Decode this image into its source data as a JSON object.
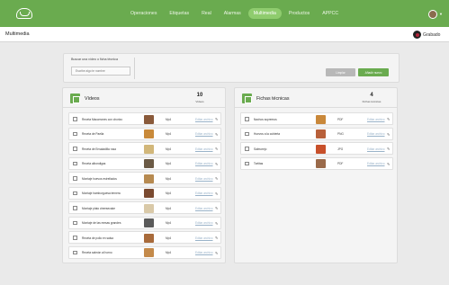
{
  "nav": {
    "items": [
      "Operaciones",
      "Etiquetas",
      "Real",
      "Alarmas",
      "Multimedia",
      "Productos",
      "APPCC"
    ],
    "active_index": 4
  },
  "subbar": {
    "title": "Multimedia",
    "record_label": "Grabado"
  },
  "search": {
    "label": "Buscar una vídeo o ficha técnica",
    "placeholder": "Escribe algo te nombre",
    "clear_label": "Limpiar",
    "add_label": "Añadir nuevo"
  },
  "videos": {
    "title": "Vídeos",
    "count": "10",
    "count_label": "Vídeos",
    "rows": [
      {
        "name": "Receta Macarrones con chorizo",
        "format": "Mp4",
        "edit": "Editar archivo",
        "thumb": "#8a5a3a"
      },
      {
        "name": "Receta de Paella",
        "format": "Mp4",
        "edit": "Editar archivo",
        "thumb": "#c98a3a"
      },
      {
        "name": "Receta de Ensaladilla rusa",
        "format": "Mp4",
        "edit": "Editar archivo",
        "thumb": "#d2b77a"
      },
      {
        "name": "Receta albondigas",
        "format": "Mp4",
        "edit": "Editar archivo",
        "thumb": "#6b5a45"
      },
      {
        "name": "Montaje huevos estrellados",
        "format": "Mp4",
        "edit": "Editar archivo",
        "thumb": "#b78a50"
      },
      {
        "name": "Montaje hamburguesa ternera",
        "format": "Mp4",
        "edit": "Editar archivo",
        "thumb": "#7a4a30"
      },
      {
        "name": "Montaje plato cheesecake",
        "format": "Mp4",
        "edit": "Editar archivo",
        "thumb": "#d9c9a8"
      },
      {
        "name": "Montaje de las mesas grandes",
        "format": "Mp4",
        "edit": "Editar archivo",
        "thumb": "#5a5a5a"
      },
      {
        "name": "Receta de pollo en salsa",
        "format": "Mp4",
        "edit": "Editar archivo",
        "thumb": "#a86a3a"
      },
      {
        "name": "Receta salmón al horno",
        "format": "Mp4",
        "edit": "Editar archivo",
        "thumb": "#c48a4a"
      }
    ]
  },
  "fichas": {
    "title": "Fichas técnicas",
    "count": "4",
    "count_label": "Fichas técnicas",
    "rows": [
      {
        "name": "Nachos supremos",
        "format": "PDF",
        "edit": "Editar archivo",
        "thumb": "#c9883a"
      },
      {
        "name": "Huevos a la cubierta",
        "format": "PNG",
        "edit": "Editar archivo",
        "thumb": "#b8603a"
      },
      {
        "name": "Salmorejo",
        "format": "JPG",
        "edit": "Editar archivo",
        "thumb": "#c8502a"
      },
      {
        "name": "Tortitas",
        "format": "PDF",
        "edit": "Editar archivo",
        "thumb": "#9a6a4a"
      }
    ]
  },
  "colors": {
    "brand": "#6aab4f",
    "nav_active": "#8fcc6e",
    "link": "#9ab3c9",
    "record": "#b0243a"
  },
  "icons": {
    "logo": "cloud-logo-icon",
    "row_edit": "pencil-icon",
    "panel": "media-icon",
    "avatar": "user-avatar"
  }
}
